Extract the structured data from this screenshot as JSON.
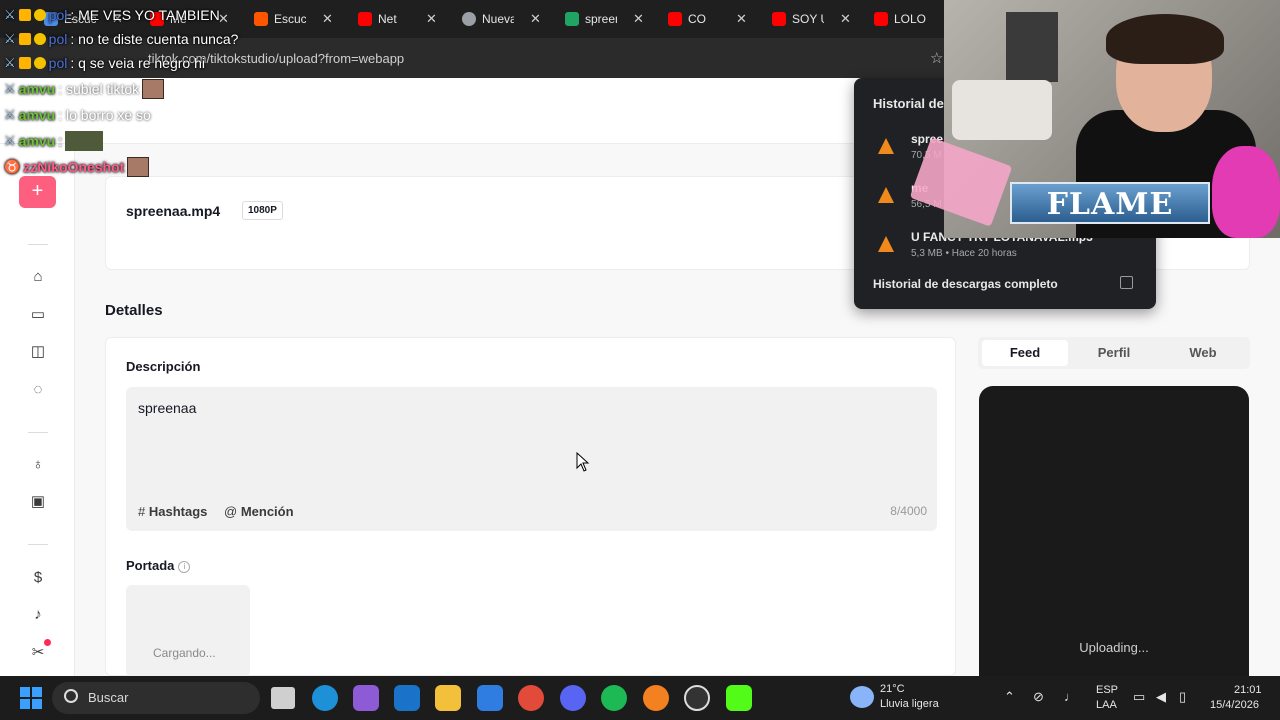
{
  "browser": {
    "tabs": [
      {
        "label": "Escuch",
        "favicon_color": "#4d8de8"
      },
      {
        "label": "Me",
        "favicon_color": "#ff0000"
      },
      {
        "label": "Escuch",
        "favicon_color": "#ff5500"
      },
      {
        "label": "Net",
        "favicon_color": "#ff0000"
      },
      {
        "label": "Nueva",
        "favicon_color": "#9aa0a6"
      },
      {
        "label": "spreen",
        "favicon_color": "#1fa463"
      },
      {
        "label": "CO",
        "favicon_color": "#ff0000"
      },
      {
        "label": "SOY UN",
        "favicon_color": "#ff0000"
      },
      {
        "label": "LOLO -",
        "favicon_color": "#ff0000"
      }
    ],
    "url": "tiktok.com/tiktokstudio/upload?from=webapp"
  },
  "chat": [
    {
      "user": "pol",
      "message": ": ME VES YO TAMBIEN"
    },
    {
      "user": "pol",
      "message": ": no te diste cuenta nunca?"
    },
    {
      "user": "pol",
      "message": ": q se veia re negro hi"
    },
    {
      "user": "amvu",
      "message": ": subiel tiktok"
    },
    {
      "user": "amvu",
      "message": ": lo borro xe so"
    },
    {
      "user": "amvu",
      "message": ":"
    },
    {
      "user": "zzNikoOneshot",
      "message": ""
    }
  ],
  "file": {
    "name": "spreenaa.mp4",
    "resolution": "1080P"
  },
  "details": {
    "title": "Detalles",
    "description_label": "Descripción",
    "description_value": "spreenaa",
    "hashtags_label": "Hashtags",
    "mention_label": "Mención",
    "counter": "8/4000",
    "cover_label": "Portada",
    "cover_status": "Cargando..."
  },
  "preview": {
    "tabs": [
      "Feed",
      "Perfil",
      "Web"
    ],
    "active_tab": "Feed",
    "status": "Uploading..."
  },
  "downloads": {
    "title": "Historial de",
    "items": [
      {
        "name": "spree",
        "meta": "70,5 M"
      },
      {
        "name": "me",
        "meta": "56,5 M"
      },
      {
        "name": "U FANCY TRY LOTANAVAL.mp3",
        "meta": "5,3 MB • Hace 20 horas"
      }
    ],
    "footer": "Historial de descargas completo"
  },
  "overlay": {
    "banner": "FLAME"
  },
  "taskbar": {
    "search_placeholder": "Buscar",
    "weather_temp": "21°C",
    "weather_desc": "Lluvia ligera",
    "lang": "ESP",
    "lang_sub": "LAA",
    "time": "21:01",
    "date": "15/4/2026"
  }
}
